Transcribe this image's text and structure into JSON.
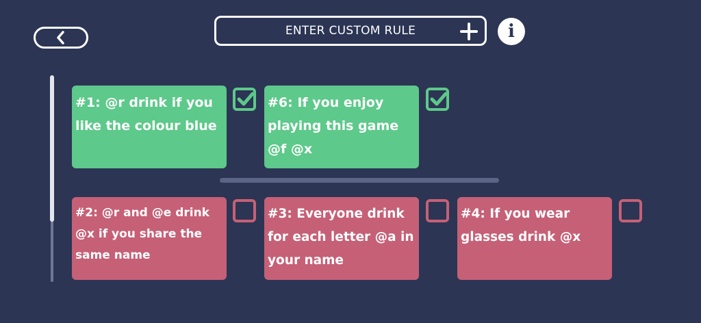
{
  "header": {
    "custom_rule_label": "ENTER CUSTOM RULE"
  },
  "icons": {
    "back": "chevron-left-icon",
    "add": "plus-icon",
    "info": "info-icon",
    "info_glyph": "i"
  },
  "colors": {
    "background": "#2c3554",
    "enabled_rule": "#5dc98a",
    "disabled_rule": "#c66077",
    "divider": "#5b6485"
  },
  "enabled_rules": [
    {
      "text": "#1: @r drink if you like the colour blue",
      "checked": true
    },
    {
      "text": "#6: If you enjoy playing this game @f @x",
      "checked": true
    }
  ],
  "disabled_rules": [
    {
      "text": "#2: @r and @e drink @x if you share the same name",
      "checked": false
    },
    {
      "text": "#3: Everyone drink for each letter @a in your name",
      "checked": false
    },
    {
      "text": "#4: If you wear glasses drink @x",
      "checked": false
    }
  ]
}
